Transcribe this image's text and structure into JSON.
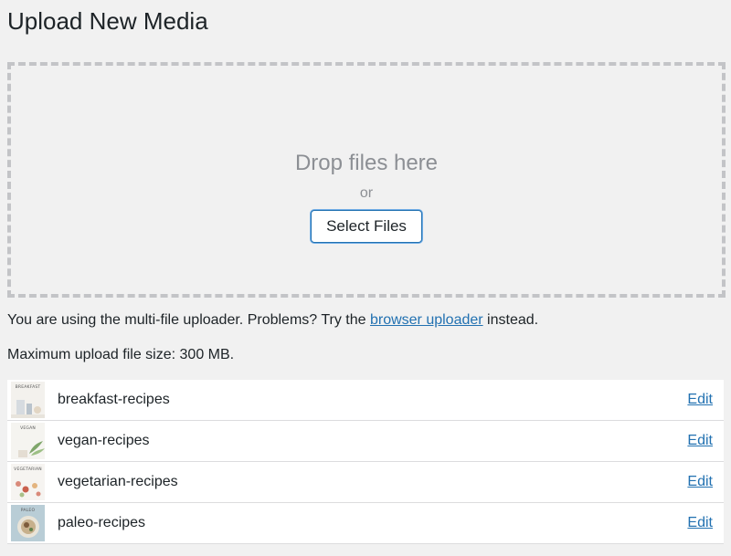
{
  "page": {
    "title": "Upload New Media"
  },
  "uploader": {
    "drop_text": "Drop files here",
    "or_text": "or",
    "select_button": "Select Files"
  },
  "info": {
    "multi_prefix": "You are using the multi-file uploader. Problems? Try the",
    "browser_link": "browser uploader",
    "multi_suffix": "instead.",
    "max_size": "Maximum upload file size: 300 MB."
  },
  "media_items": [
    {
      "name": "breakfast-recipes",
      "thumb_label": "BREAKFAST",
      "edit_label": "Edit"
    },
    {
      "name": "vegan-recipes",
      "thumb_label": "VEGAN",
      "edit_label": "Edit"
    },
    {
      "name": "vegetarian-recipes",
      "thumb_label": "VEGETARIAN",
      "edit_label": "Edit"
    },
    {
      "name": "paleo-recipes",
      "thumb_label": "PALEO",
      "edit_label": "Edit"
    }
  ],
  "colors": {
    "link": "#2271b1",
    "background": "#f1f1f1",
    "dashed_border": "#c3c4c7",
    "muted_text": "#8c8f94"
  }
}
